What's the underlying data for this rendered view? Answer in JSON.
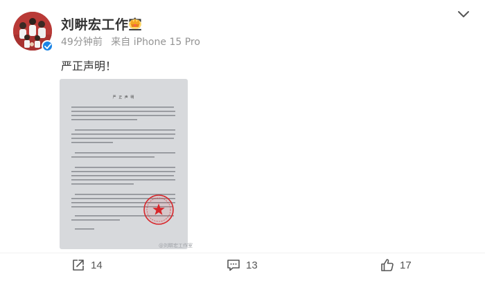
{
  "header": {
    "name": "刘畊宏工作室",
    "time": "49分钟前",
    "source": "来自 iPhone 15 Pro"
  },
  "post": {
    "text": "严正声明！",
    "image": {
      "doc_title": "严 正 声 明",
      "watermark": "@刘畊宏工作室"
    }
  },
  "actions": {
    "share_count": "14",
    "comment_count": "13",
    "like_count": "17"
  },
  "colors": {
    "verified_blue": "#1a84e6",
    "seal_red": "#d8262b",
    "avatar_bg": "#b93a37"
  },
  "icons": [
    "verified-icon",
    "vip-crown-icon",
    "chevron-down-icon",
    "share-icon",
    "comment-icon",
    "like-icon"
  ]
}
